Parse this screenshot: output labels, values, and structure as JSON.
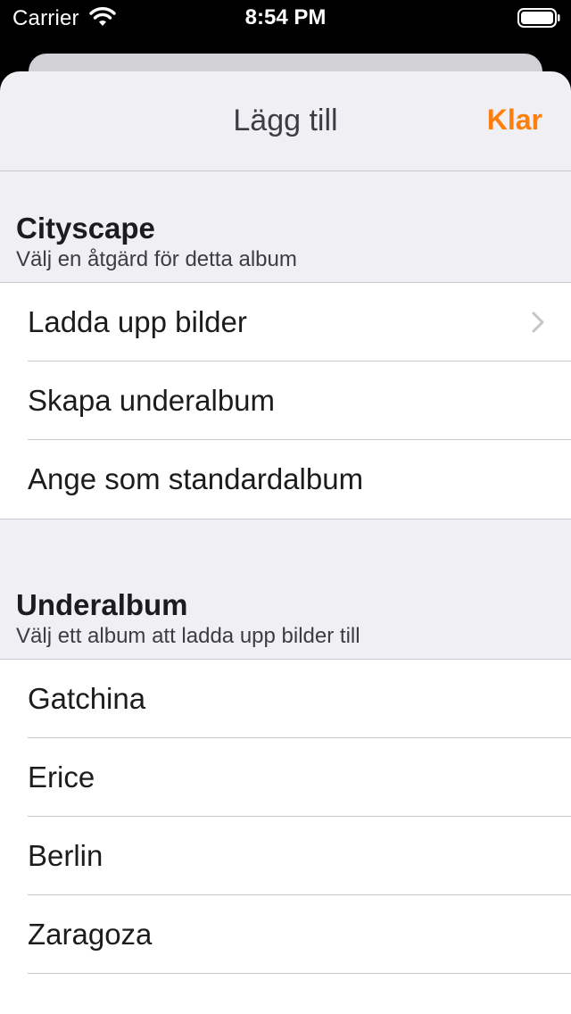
{
  "status": {
    "carrier": "Carrier",
    "time": "8:54 PM"
  },
  "nav": {
    "title": "Lägg till",
    "done_label": "Klar"
  },
  "colors": {
    "accent": "#ff7f0e",
    "sheet_background": "#efeff4"
  },
  "section_actions": {
    "title": "Cityscape",
    "subtitle": "Välj en åtgärd för detta album",
    "items": [
      {
        "label": "Ladda upp bilder",
        "icon": "chevron-right-icon"
      },
      {
        "label": "Skapa underalbum"
      },
      {
        "label": "Ange som standardalbum"
      }
    ]
  },
  "section_subalbums": {
    "title": "Underalbum",
    "subtitle": "Välj ett album att ladda upp bilder till",
    "items": [
      {
        "label": "Gatchina"
      },
      {
        "label": "Erice"
      },
      {
        "label": "Berlin"
      },
      {
        "label": "Zaragoza"
      }
    ]
  }
}
